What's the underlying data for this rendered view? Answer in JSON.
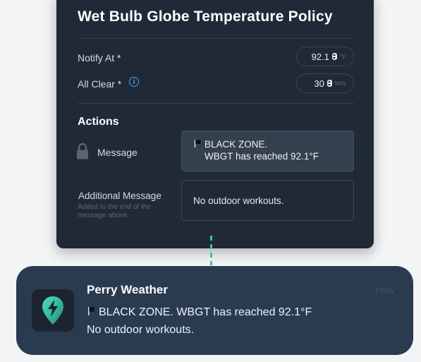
{
  "policy": {
    "title": "Wet Bulb Globe Temperature Policy",
    "notify_at": {
      "label": "Notify At *",
      "value": "92.1",
      "unit": "°F"
    },
    "all_clear": {
      "label": "All Clear *",
      "value": "30",
      "unit": "MIN"
    }
  },
  "actions": {
    "title": "Actions",
    "message": {
      "label": "Message",
      "line1": "BLACK ZONE.",
      "line2": "WBGT has reached 92.1°F"
    },
    "additional": {
      "label": "Additional Message",
      "help": "Added to the end of the message above.",
      "value": "No outdoor workouts."
    }
  },
  "notification": {
    "app_name": "Perry Weather",
    "time": "now",
    "line1": "BLACK ZONE. WBGT has reached 92.1°F",
    "line2": "No outdoor workouts."
  },
  "colors": {
    "panel": "#1f2a36",
    "notification": "#2a3b50",
    "accent": "#34c6a7",
    "info": "#4aa3ff"
  }
}
